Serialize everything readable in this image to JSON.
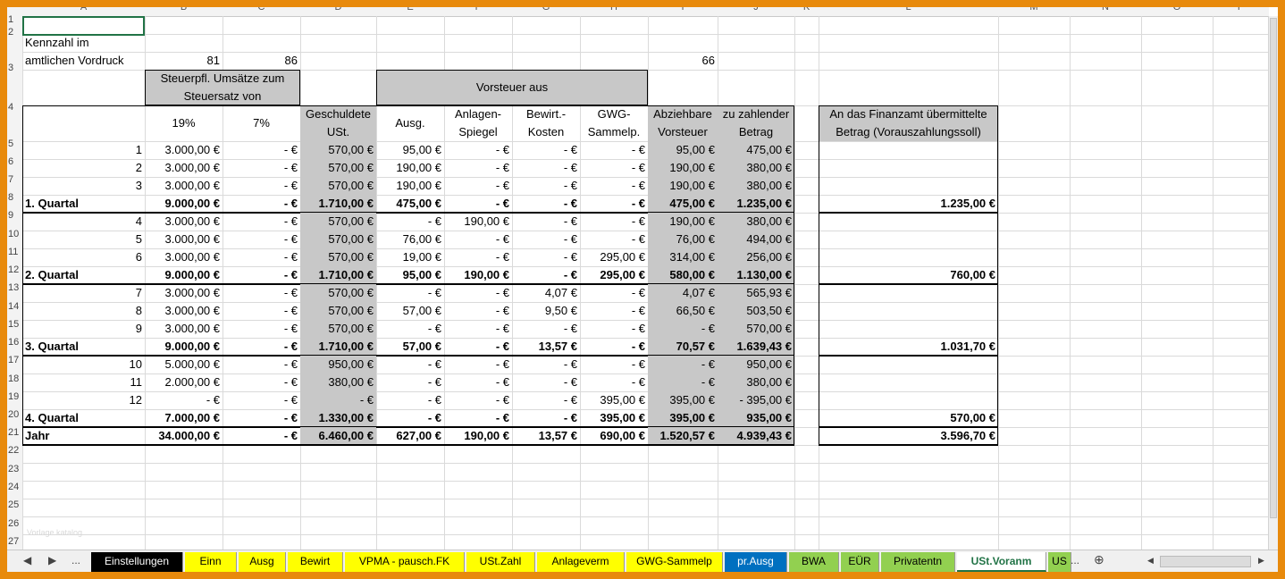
{
  "columns": [
    "A",
    "B",
    "C",
    "D",
    "E",
    "F",
    "G",
    "H",
    "I",
    "J",
    "K",
    "L",
    "M",
    "N",
    "O",
    "P"
  ],
  "rows": [
    "1",
    "2",
    "3",
    "4",
    "5",
    "6",
    "7",
    "8",
    "9",
    "10",
    "11",
    "12",
    "13",
    "14",
    "15",
    "16",
    "17",
    "18",
    "19",
    "20",
    "21",
    "22",
    "23",
    "24",
    "25",
    "26",
    "27"
  ],
  "header": {
    "kennzahl_line1": "Kennzahl im",
    "kennzahl_line2": "amtlichen Vordruck",
    "kz_b": "81",
    "kz_c": "86",
    "kz_i": "66",
    "steuerpfl": "Steuerpfl. Umsätze zum Steuersatz von",
    "vorsteuer_aus": "Vorsteuer aus",
    "pct19": "19%",
    "pct7": "7%",
    "geschuldete": "Geschuldete USt.",
    "ausg": "Ausg.",
    "anlagen": "Anlagen-Spiegel",
    "bewirt": "Bewirt.-Kosten",
    "gwg": "GWG-Sammelp.",
    "abziehbare": "Abziehbare Vorsteuer",
    "zu_zahlender": "zu zahlender Betrag",
    "finanzamt": "An das Finanzamt übermittelte Betrag (Vorauszahlungssoll)"
  },
  "data_rows": [
    {
      "a": "1",
      "b": "3.000,00 €",
      "c": "-   €",
      "d": "570,00 €",
      "e": "95,00 €",
      "f": "-   €",
      "g": "-   €",
      "h": "-   €",
      "i": "95,00 €",
      "j": "475,00 €",
      "l": "",
      "bold": false
    },
    {
      "a": "2",
      "b": "3.000,00 €",
      "c": "-   €",
      "d": "570,00 €",
      "e": "190,00 €",
      "f": "-   €",
      "g": "-   €",
      "h": "-   €",
      "i": "190,00 €",
      "j": "380,00 €",
      "l": "",
      "bold": false
    },
    {
      "a": "3",
      "b": "3.000,00 €",
      "c": "-   €",
      "d": "570,00 €",
      "e": "190,00 €",
      "f": "-   €",
      "g": "-   €",
      "h": "-   €",
      "i": "190,00 €",
      "j": "380,00 €",
      "l": "",
      "bold": false
    },
    {
      "a": "1. Quartal",
      "b": "9.000,00 €",
      "c": "-   €",
      "d": "1.710,00 €",
      "e": "475,00 €",
      "f": "-   €",
      "g": "-   €",
      "h": "-   €",
      "i": "475,00 €",
      "j": "1.235,00 €",
      "l": "1.235,00 €",
      "bold": true
    },
    {
      "a": "4",
      "b": "3.000,00 €",
      "c": "-   €",
      "d": "570,00 €",
      "e": "-   €",
      "f": "190,00 €",
      "g": "-   €",
      "h": "-   €",
      "i": "190,00 €",
      "j": "380,00 €",
      "l": "",
      "bold": false
    },
    {
      "a": "5",
      "b": "3.000,00 €",
      "c": "-   €",
      "d": "570,00 €",
      "e": "76,00 €",
      "f": "-   €",
      "g": "-   €",
      "h": "-   €",
      "i": "76,00 €",
      "j": "494,00 €",
      "l": "",
      "bold": false
    },
    {
      "a": "6",
      "b": "3.000,00 €",
      "c": "-   €",
      "d": "570,00 €",
      "e": "19,00 €",
      "f": "-   €",
      "g": "-   €",
      "h": "295,00 €",
      "i": "314,00 €",
      "j": "256,00 €",
      "l": "",
      "bold": false
    },
    {
      "a": "2. Quartal",
      "b": "9.000,00 €",
      "c": "-   €",
      "d": "1.710,00 €",
      "e": "95,00 €",
      "f": "190,00 €",
      "g": "-   €",
      "h": "295,00 €",
      "i": "580,00 €",
      "j": "1.130,00 €",
      "l": "760,00 €",
      "bold": true
    },
    {
      "a": "7",
      "b": "3.000,00 €",
      "c": "-   €",
      "d": "570,00 €",
      "e": "-   €",
      "f": "-   €",
      "g": "4,07 €",
      "h": "-   €",
      "i": "4,07 €",
      "j": "565,93 €",
      "l": "",
      "bold": false
    },
    {
      "a": "8",
      "b": "3.000,00 €",
      "c": "-   €",
      "d": "570,00 €",
      "e": "57,00 €",
      "f": "-   €",
      "g": "9,50 €",
      "h": "-   €",
      "i": "66,50 €",
      "j": "503,50 €",
      "l": "",
      "bold": false
    },
    {
      "a": "9",
      "b": "3.000,00 €",
      "c": "-   €",
      "d": "570,00 €",
      "e": "-   €",
      "f": "-   €",
      "g": "-   €",
      "h": "-   €",
      "i": "-   €",
      "j": "570,00 €",
      "l": "",
      "bold": false
    },
    {
      "a": "3. Quartal",
      "b": "9.000,00 €",
      "c": "-   €",
      "d": "1.710,00 €",
      "e": "57,00 €",
      "f": "-   €",
      "g": "13,57 €",
      "h": "-   €",
      "i": "70,57 €",
      "j": "1.639,43 €",
      "l": "1.031,70 €",
      "bold": true
    },
    {
      "a": "10",
      "b": "5.000,00 €",
      "c": "-   €",
      "d": "950,00 €",
      "e": "-   €",
      "f": "-   €",
      "g": "-   €",
      "h": "-   €",
      "i": "-   €",
      "j": "950,00 €",
      "l": "",
      "bold": false
    },
    {
      "a": "11",
      "b": "2.000,00 €",
      "c": "-   €",
      "d": "380,00 €",
      "e": "-   €",
      "f": "-   €",
      "g": "-   €",
      "h": "-   €",
      "i": "-   €",
      "j": "380,00 €",
      "l": "",
      "bold": false
    },
    {
      "a": "12",
      "b": "-   €",
      "c": "-   €",
      "d": "-   €",
      "e": "-   €",
      "f": "-   €",
      "g": "-   €",
      "h": "395,00 €",
      "i": "395,00 €",
      "j": "-    395,00 €",
      "l": "",
      "bold": false
    },
    {
      "a": "4. Quartal",
      "b": "7.000,00 €",
      "c": "-   €",
      "d": "1.330,00 €",
      "e": "-   €",
      "f": "-   €",
      "g": "-   €",
      "h": "395,00 €",
      "i": "395,00 €",
      "j": "935,00 €",
      "l": "570,00 €",
      "bold": true
    },
    {
      "a": "Jahr",
      "b": "34.000,00 €",
      "c": "-   €",
      "d": "6.460,00 €",
      "e": "627,00 €",
      "f": "190,00 €",
      "g": "13,57 €",
      "h": "690,00 €",
      "i": "1.520,57 €",
      "j": "4.939,43 €",
      "l": "3.596,70 €",
      "bold": true
    }
  ],
  "watermark": "Vorlage.katalog",
  "tabs": [
    {
      "label": "Einstellungen",
      "bg": "#000000",
      "fg": "#ffffff"
    },
    {
      "label": "Einn",
      "bg": "#ffff00",
      "fg": "#000000"
    },
    {
      "label": "Ausg",
      "bg": "#ffff00",
      "fg": "#000000"
    },
    {
      "label": "Bewirt",
      "bg": "#ffff00",
      "fg": "#000000"
    },
    {
      "label": "VPMA - pausch.FK",
      "bg": "#ffff00",
      "fg": "#000000"
    },
    {
      "label": "USt.Zahl",
      "bg": "#ffff00",
      "fg": "#000000"
    },
    {
      "label": "Anlageverm",
      "bg": "#ffff00",
      "fg": "#000000"
    },
    {
      "label": "GWG-Sammelp",
      "bg": "#ffff00",
      "fg": "#000000"
    },
    {
      "label": "pr.Ausg",
      "bg": "#0070c0",
      "fg": "#ffffff"
    },
    {
      "label": "BWA",
      "bg": "#92d050",
      "fg": "#000000"
    },
    {
      "label": "EÜR",
      "bg": "#92d050",
      "fg": "#000000"
    },
    {
      "label": "Privatentn",
      "bg": "#92d050",
      "fg": "#000000"
    },
    {
      "label": "USt.Voranm",
      "bg": "#ffffff",
      "fg": "#217346",
      "active": true
    },
    {
      "label": "US",
      "bg": "#92d050",
      "fg": "#000000"
    }
  ],
  "nav": {
    "prev": "◀",
    "next": "▶",
    "more": "...",
    "more2": "...",
    "add": "⊕",
    "scroll_left": "◀",
    "scroll_right": "▶"
  },
  "colors": {
    "frame": "#e88a0c",
    "gray_cell": "#c8c8c8",
    "select": "#217346"
  }
}
